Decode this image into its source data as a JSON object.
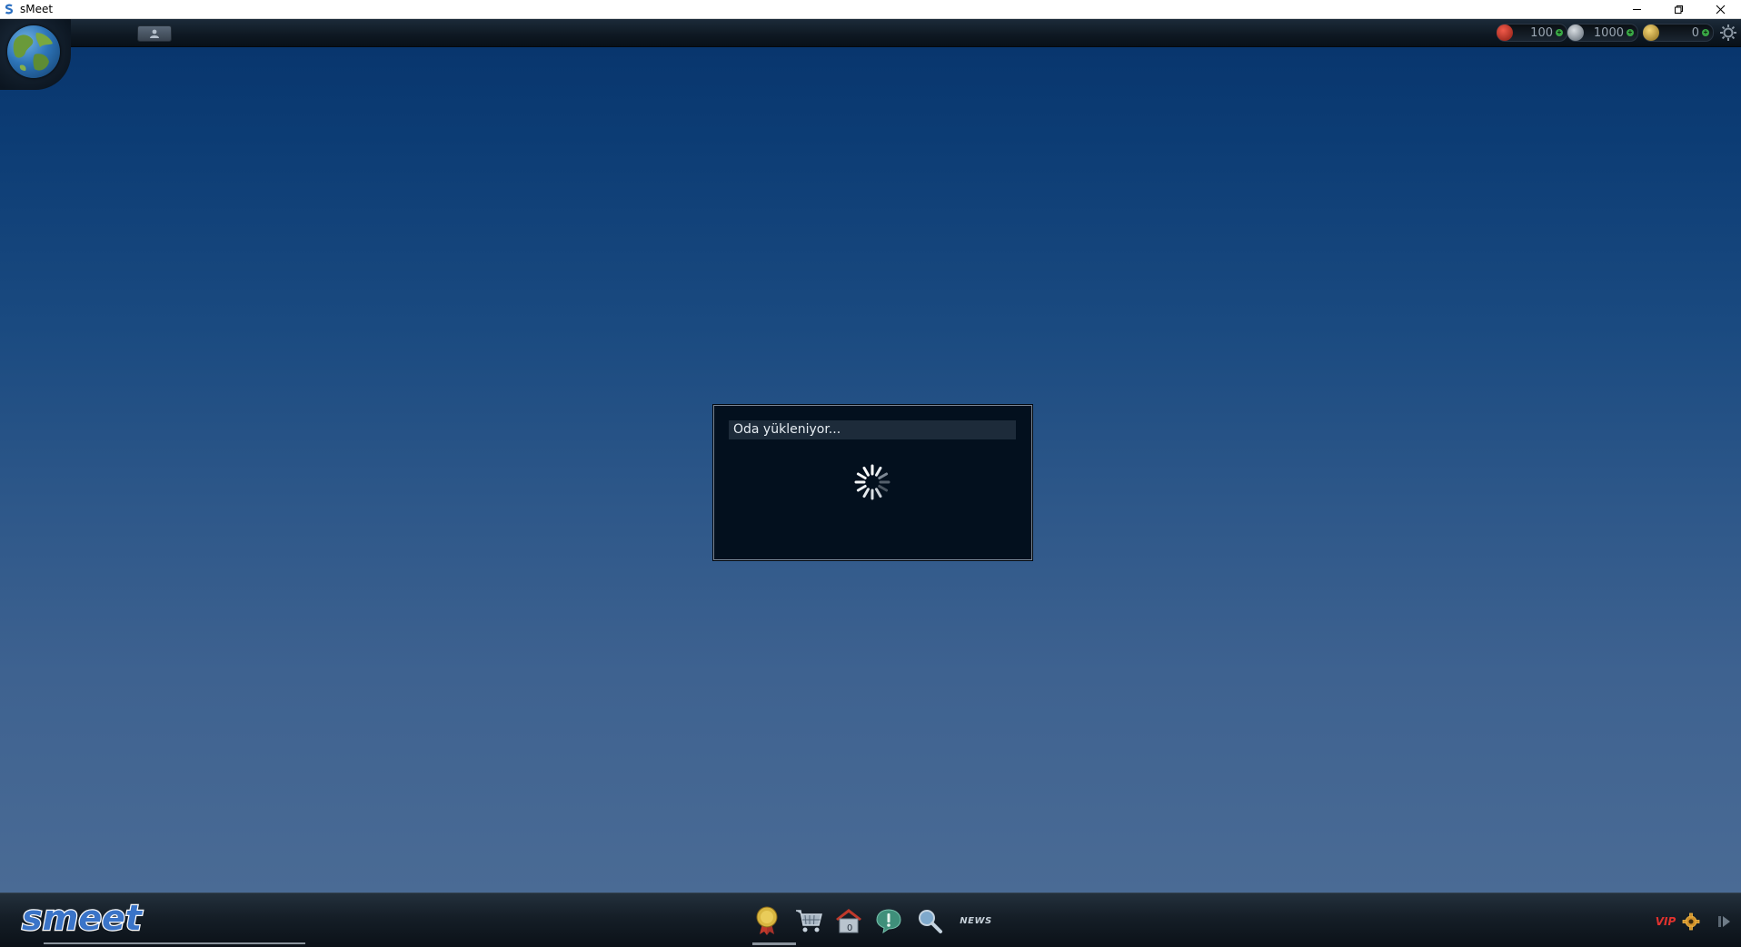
{
  "window": {
    "title": "sMeet",
    "minimize_icon": "minimize-icon",
    "restore_icon": "restore-icon",
    "close_icon": "close-icon"
  },
  "topbar": {
    "globe_icon": "globe-icon",
    "profile_icon": "profile-icon",
    "currencies": [
      {
        "icon": "red-coin-icon",
        "value": "100",
        "color": "#c0392b"
      },
      {
        "icon": "silver-coin-icon",
        "value": "1000",
        "color": "#8e99a3"
      },
      {
        "icon": "gold-coin-icon",
        "value": "0",
        "color": "#c8a23a"
      }
    ],
    "settings_icon": "gear-icon"
  },
  "dialog": {
    "title": "Oda yükleniyor...",
    "spinner_icon": "loading-spinner-icon"
  },
  "bottombar": {
    "logo_text": "smeet",
    "dock": [
      {
        "icon": "award-medal-icon"
      },
      {
        "icon": "shopping-cart-icon"
      },
      {
        "icon": "home-icon",
        "badge": "0"
      },
      {
        "icon": "alert-bubble-icon"
      },
      {
        "icon": "search-icon"
      },
      {
        "icon": "news-icon",
        "label": "NEWS"
      }
    ],
    "vip_label": "VIP",
    "right_icons": [
      "vip-icon",
      "gold-gear-icon",
      "collapse-arrow-icon"
    ]
  },
  "colors": {
    "bg_top": "#07346c",
    "bg_bottom": "#4a6b95",
    "dialog_bg": "#03101e"
  }
}
